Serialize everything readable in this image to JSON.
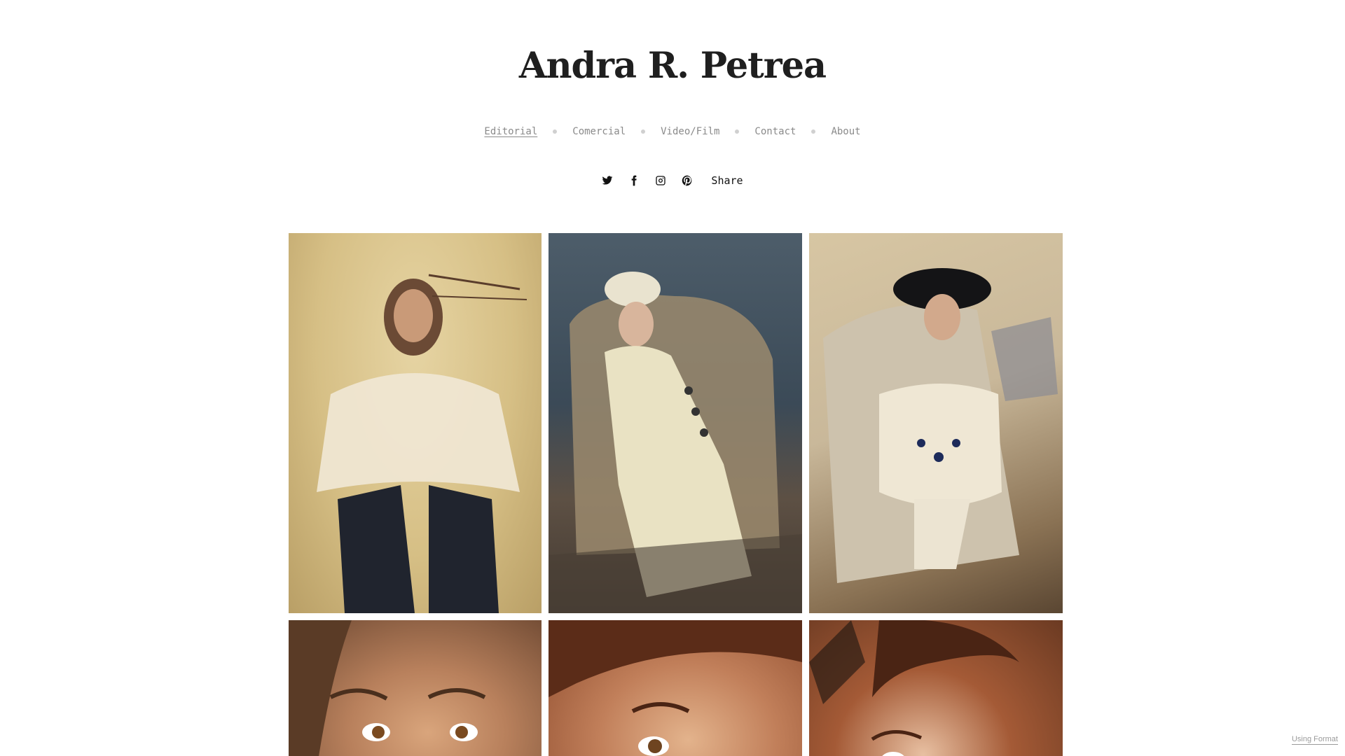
{
  "site": {
    "title": "Andra R. Petrea"
  },
  "nav": {
    "items": [
      {
        "label": "Editorial",
        "active": true
      },
      {
        "label": "Comercial",
        "active": false
      },
      {
        "label": "Video/Film",
        "active": false
      },
      {
        "label": "Contact",
        "active": false
      },
      {
        "label": "About",
        "active": false
      }
    ]
  },
  "social": {
    "icons": [
      "twitter-icon",
      "facebook-icon",
      "instagram-icon",
      "pinterest-icon"
    ],
    "share_label": "Share"
  },
  "gallery": {
    "photos": [
      {
        "subject": "model in ruffled cream blouse and dark studded pants, cream backdrop"
      },
      {
        "subject": "model in white beret and lace coat in armchair, blue wall"
      },
      {
        "subject": "model in black hat and ruffled white dress on couch"
      },
      {
        "subject": "close-up portrait, freckles, brown eyes"
      },
      {
        "subject": "close-up portrait, curly hair, warm background"
      },
      {
        "subject": "close-up portrait, updo, orange background"
      }
    ]
  },
  "footer": {
    "using_format": "Using Format"
  },
  "colors": {
    "title": "#1f1f1f",
    "nav_text": "#8a8a8a",
    "nav_dot": "#d0d0d0",
    "icon": "#111111"
  }
}
